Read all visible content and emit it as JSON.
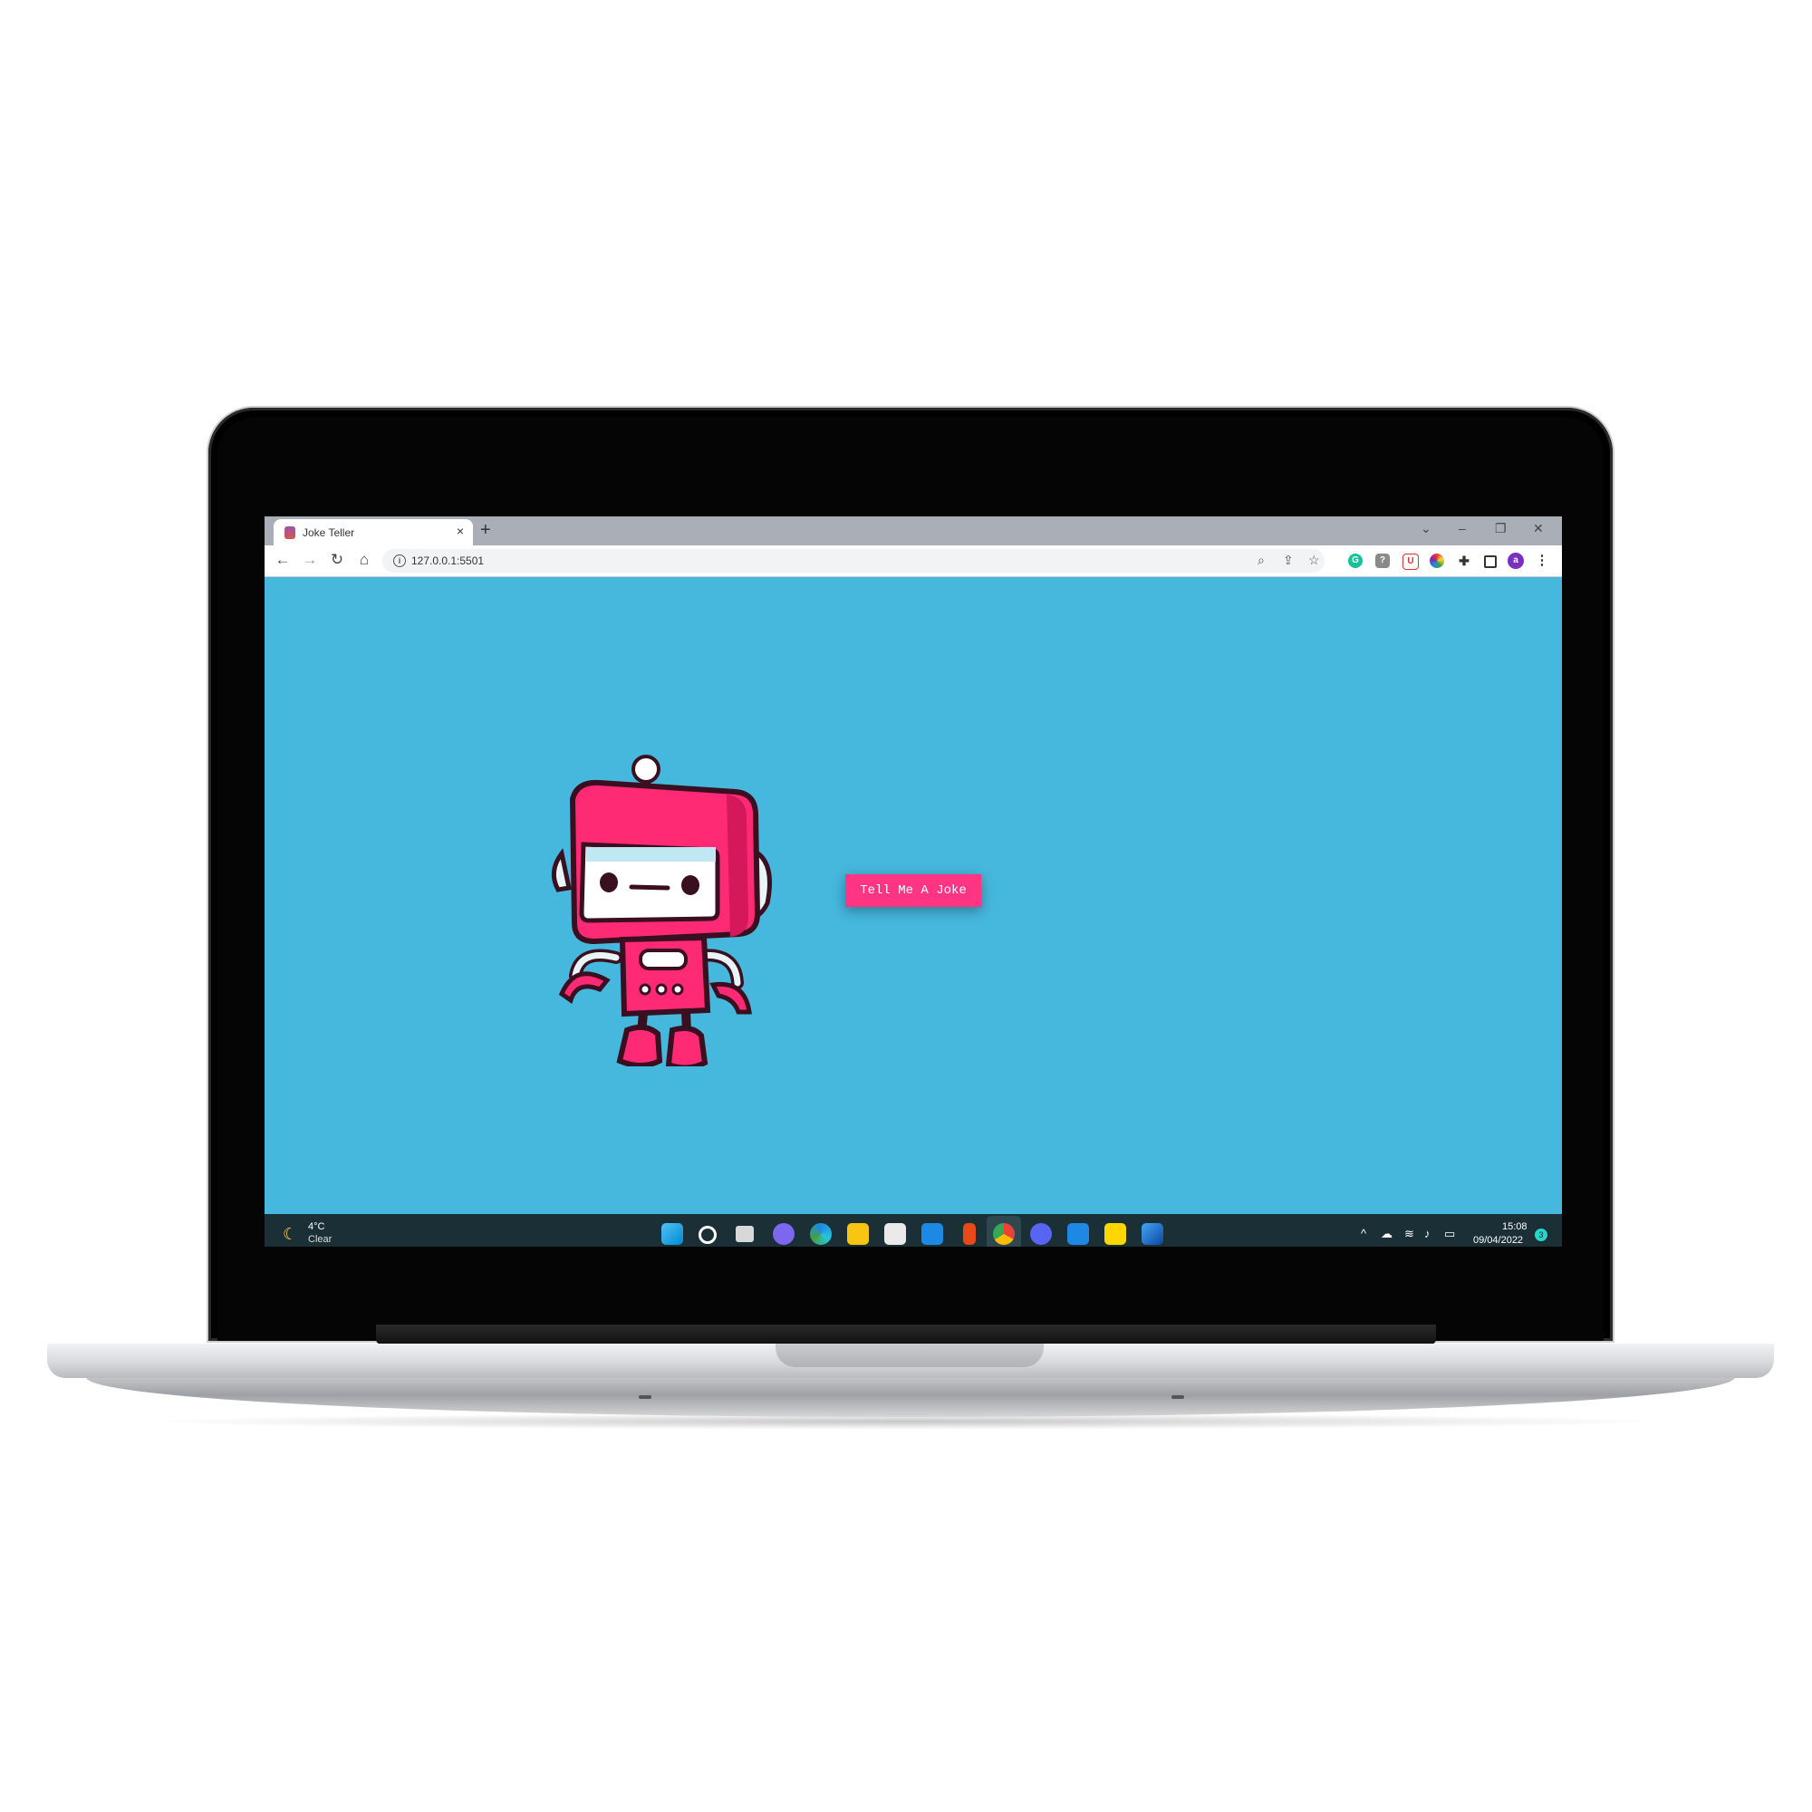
{
  "browser": {
    "tab_title": "Joke Teller",
    "tab_close": "×",
    "new_tab": "+",
    "url": "127.0.0.1:5501",
    "profile_initial": "a"
  },
  "page": {
    "button_label": "Tell Me A Joke",
    "background_color": "#46b7dd",
    "button_color": "#ff3482",
    "robot_color": "#ff2a73"
  },
  "taskbar": {
    "weather_temp": "4°C",
    "weather_condition": "Clear",
    "clock_time": "15:08",
    "clock_date": "09/04/2022",
    "notification_count": "3",
    "apps": [
      "start",
      "search",
      "task-view",
      "teams-chat",
      "edge",
      "file-explorer",
      "store",
      "mail",
      "office",
      "chrome",
      "discord",
      "vscode",
      "sticky-notes",
      "photos"
    ]
  }
}
